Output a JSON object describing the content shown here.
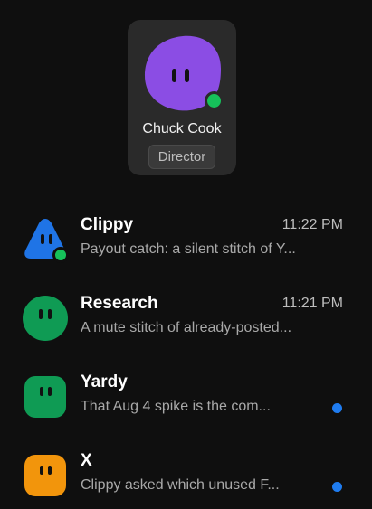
{
  "profile": {
    "name": "Chuck Cook",
    "role": "Director",
    "avatar_color": "#8b4de4",
    "status": "online",
    "status_color": "#16c15a"
  },
  "conversations": [
    {
      "name": "Clippy",
      "time": "11:22 PM",
      "preview": "Payout catch: a silent stitch of Y...",
      "avatar_shape": "triangle",
      "avatar_color": "#1f74e6",
      "online": true,
      "unread": false
    },
    {
      "name": "Research",
      "time": "11:21 PM",
      "preview": "A mute stitch of already-posted...",
      "avatar_shape": "circle",
      "avatar_color": "#0f9b54",
      "online": false,
      "unread": false
    },
    {
      "name": "Yardy",
      "time": "",
      "preview": "That Aug 4 spike is the com...",
      "avatar_shape": "rounded-square",
      "avatar_color": "#0f9b54",
      "online": false,
      "unread": true
    },
    {
      "name": "X",
      "time": "",
      "preview": "Clippy asked which unused F...",
      "avatar_shape": "rounded-square",
      "avatar_color": "#f2950c",
      "online": false,
      "unread": true
    }
  ],
  "colors": {
    "background": "#0f0f0f",
    "card": "#2a2a2a",
    "unread_dot": "#1f7cf0"
  }
}
